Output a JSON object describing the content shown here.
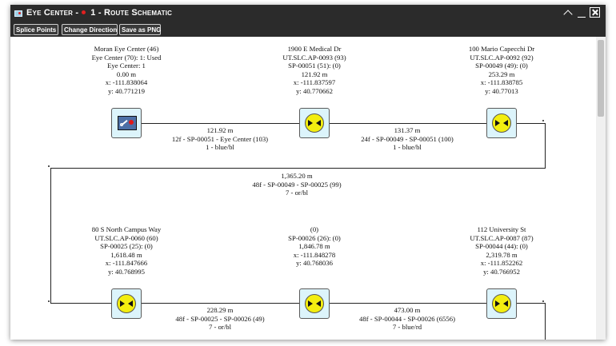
{
  "window": {
    "title_prefix": "Eye Center -",
    "title_main": "1 - Route Schematic"
  },
  "toolbar": {
    "splice_points": "Splice Points",
    "change_direction": "Change Direction",
    "save_png": "Save as PNG"
  },
  "nodes": [
    {
      "lines": [
        "Moran Eye Center (46)",
        "Eye Center (70): 1: Used",
        "Eye Center: 1",
        "0.00 m",
        "x: -111.838064",
        "y: 40.771219"
      ]
    },
    {
      "lines": [
        "1900 E Medical Dr",
        "UT.SLC.AP-0093 (93)",
        "SP-00051 (51): (0)",
        "121.92 m",
        "x: -111.837597",
        "y: 40.770662"
      ]
    },
    {
      "lines": [
        "100 Mario Capecchi Dr",
        "UT.SLC.AP-0092 (92)",
        "SP-00049 (49): (0)",
        "253.29 m",
        "x: -111.838785",
        "y: 40.77013"
      ]
    },
    {
      "lines": [
        "80 S North Campus Way",
        "UT.SLC.AP-0060 (60)",
        "SP-00025 (25): (0)",
        "1,618.48 m",
        "x: -111.847666",
        "y: 40.768995"
      ]
    },
    {
      "lines": [
        "(0)",
        "SP-00026 (26): (0)",
        "1,846.78 m",
        "x: -111.848278",
        "y: 40.768036"
      ]
    },
    {
      "lines": [
        "112 University St",
        "UT.SLC.AP-0087 (87)",
        "SP-00044 (44): (0)",
        "2,319.78 m",
        "x: -111.852262",
        "y: 40.766952"
      ]
    }
  ],
  "segments": [
    {
      "lines": [
        "121.92 m",
        "12f - SP-00051 - Eye Center (103)",
        "1 - blue/bl"
      ]
    },
    {
      "lines": [
        "131.37 m",
        "24f - SP-00049 - SP-00051 (100)",
        "1 - blue/bl"
      ]
    },
    {
      "lines": [
        "1,365.20 m",
        "48f - SP-00049 - SP-00025 (99)",
        "7 - or/bl"
      ]
    },
    {
      "lines": [
        "228.29 m",
        "48f - SP-00025 - SP-00026 (49)",
        "7 - or/bl"
      ]
    },
    {
      "lines": [
        "473.00 m",
        "48f - SP-00044 - SP-00026 (6556)",
        "7 - blue/rd"
      ]
    }
  ],
  "icons": {
    "node_first": "equipment-icon",
    "node_other": "splice-point-icon"
  },
  "colors": {
    "titlebar": "#2b2b2b",
    "node_fill": "#dcf4fb",
    "splice_fill": "#f3ee10",
    "equipment_fill": "#4c6fa6",
    "marker_red": "#e01818"
  }
}
